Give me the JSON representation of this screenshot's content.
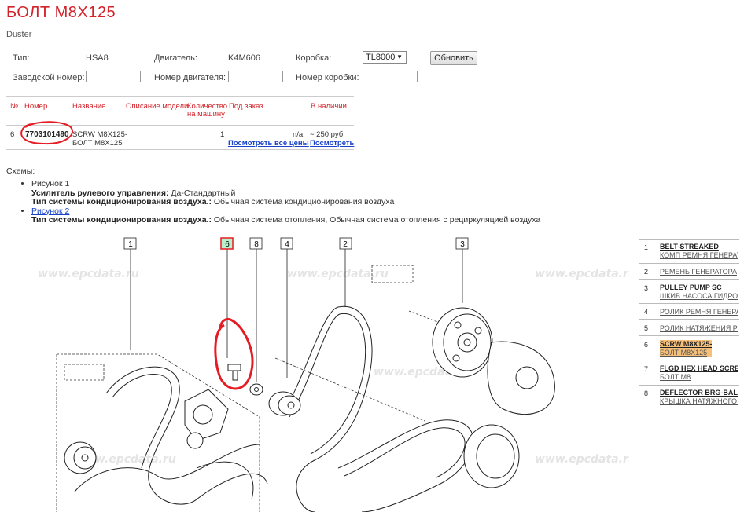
{
  "page": {
    "title": "БОЛТ M8X125",
    "subtitle": "Duster"
  },
  "filters": {
    "type_label": "Тип:",
    "type_value": "HSA8",
    "engine_label": "Двигатель:",
    "engine_value": "K4M606",
    "gearbox_label": "Коробка:",
    "gearbox_value": "TL8000",
    "update_button": "Обновить",
    "factory_label": "Заводской номер:",
    "factory_value": "",
    "engine_no_label": "Номер двигателя:",
    "engine_no_value": "",
    "gearbox_no_label": "Номер коробки:",
    "gearbox_no_value": ""
  },
  "table": {
    "headers": {
      "num": "№",
      "part_no": "Номер",
      "name": "Название",
      "desc": "Описание модели",
      "qty1": "Количество",
      "qty2": "на машину",
      "order": "Под заказ",
      "stock": "В наличии"
    },
    "rows": [
      {
        "num": "6",
        "part_no": "7703101490",
        "name1": "SCRW M8X125-",
        "name2": "БОЛТ M8X125",
        "desc": "",
        "qty": "1",
        "order_val": "n/a",
        "order_link": "Посмотреть все цены",
        "stock_val": "~ 250 руб.",
        "stock_link": "Посмотреть"
      }
    ]
  },
  "schemes": {
    "label": "Схемы:",
    "items": [
      {
        "title": "Рисунок 1",
        "line1_key": "Усилитель рулевого управления:",
        "line1_val": " Да-Стандартный",
        "line2_key": "Тип системы кондиционирования воздуха.:",
        "line2_val": " Обычная система кондиционирования воздуха"
      },
      {
        "title": "Рисунок 2",
        "line1_key": "Тип системы кондиционирования воздуха.:",
        "line1_val": " Обычная система отопления, Обычная система отопления с рециркуляцией воздуха"
      }
    ]
  },
  "diagram": {
    "watermark": "www.epcdata.ru",
    "callouts": [
      "1",
      "6",
      "8",
      "4",
      "2",
      "3"
    ]
  },
  "legend": [
    {
      "num": "1",
      "line1": "BELT-STREAKED",
      "line2": "КОМП РЕМНЯ ГЕНЕРАТ",
      "highlight": false
    },
    {
      "num": "2",
      "line1": "",
      "line2": "РЕМЕНЬ ГЕНЕРАТОРА",
      "highlight": false
    },
    {
      "num": "3",
      "line1": "PULLEY PUMP SC",
      "line2": "ШКИВ НАСОСА ГИДРОУ",
      "highlight": false
    },
    {
      "num": "4",
      "line1": "",
      "line2": "РОЛИК РЕМНЯ ГЕНЕРА",
      "highlight": false
    },
    {
      "num": "5",
      "line1": "",
      "line2": "РОЛИК НАТЯЖЕНИЯ РЕ",
      "highlight": false
    },
    {
      "num": "6",
      "line1": "SCRW M8X125-",
      "line2": "БОЛТ M8X125",
      "highlight": true
    },
    {
      "num": "7",
      "line1": "FLGD HEX HEAD SCRE",
      "line2": "БОЛТ M8",
      "highlight": false
    },
    {
      "num": "8",
      "line1": "DEFLECTOR BRG-BALL",
      "line2": "КРЫШКА НАТЯЖНОГО Р",
      "highlight": false
    }
  ]
}
